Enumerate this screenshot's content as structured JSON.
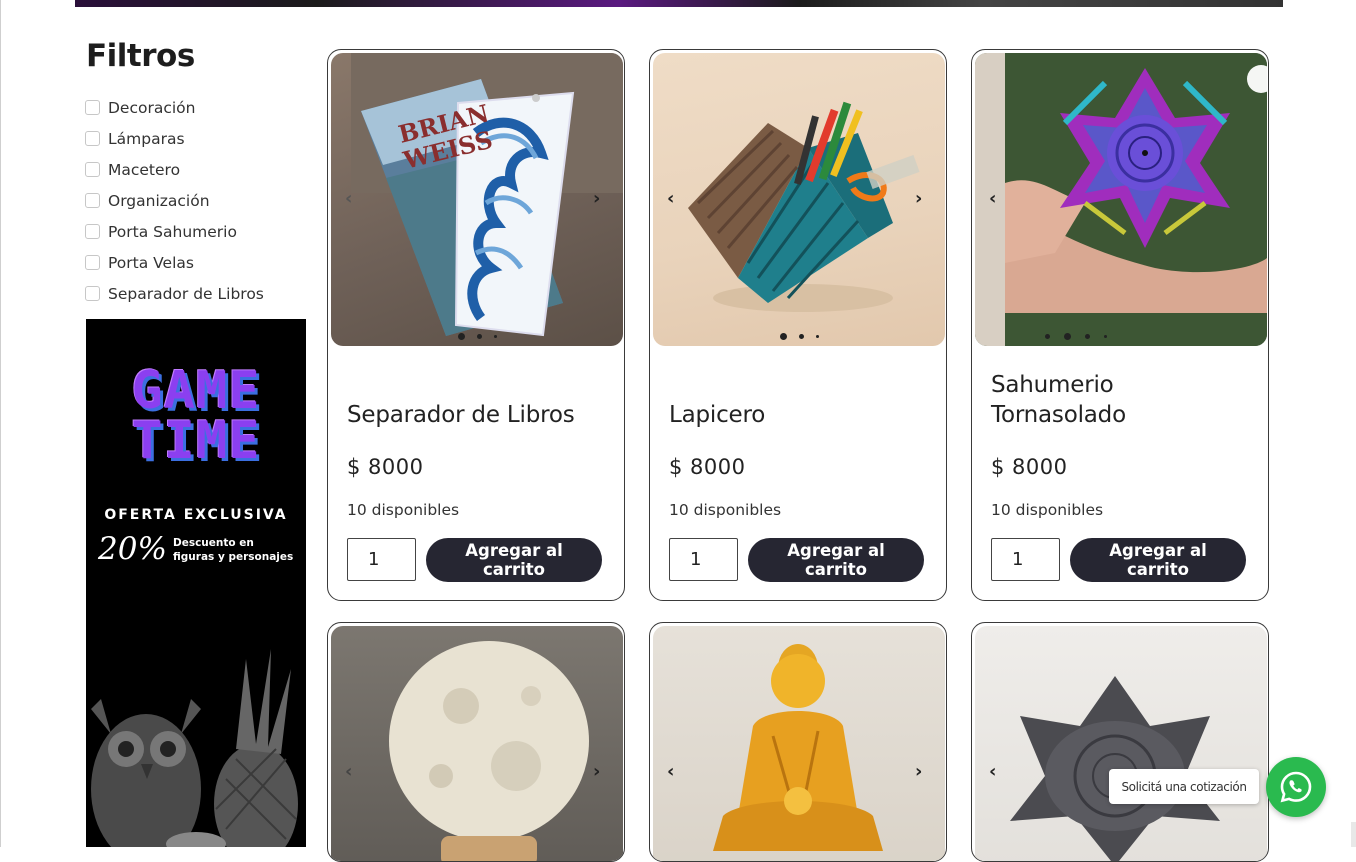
{
  "sidebar": {
    "title": "Filtros",
    "filters": [
      {
        "label": "Decoración",
        "checked": false
      },
      {
        "label": "Lámparas",
        "checked": false
      },
      {
        "label": "Macetero",
        "checked": false
      },
      {
        "label": "Organización",
        "checked": false
      },
      {
        "label": "Porta Sahumerio",
        "checked": false
      },
      {
        "label": "Porta Velas",
        "checked": false
      },
      {
        "label": "Separador de Libros",
        "checked": false
      }
    ]
  },
  "promo": {
    "line1": "GAME",
    "line2": "TIME",
    "offer": "OFERTA EXCLUSIVA",
    "percent": "20%",
    "desc_line1": "Descuento en",
    "desc_line2": "figuras y personajes"
  },
  "products": [
    {
      "title": "Separador de Libros",
      "price": "$ 8000",
      "stock": "10 disponibles",
      "qty": "1",
      "button": "Agregar al carrito",
      "image": "book-bookmark-wave",
      "slides": 3,
      "active_slide": 0
    },
    {
      "title": "Lapicero",
      "price": "$ 8000",
      "stock": "10 disponibles",
      "qty": "1",
      "button": "Agregar al carrito",
      "image": "pencil-holder",
      "slides": 3,
      "active_slide": 0
    },
    {
      "title": "Sahumerio Tornasolado",
      "price": "$ 8000",
      "stock": "10 disponibles",
      "qty": "1",
      "button": "Agregar al carrito",
      "image": "iridescent-lotus-incense-holder",
      "slides": 4,
      "active_slide": 1
    },
    {
      "image": "moon-lamp"
    },
    {
      "image": "golden-buddha"
    },
    {
      "image": "gray-lotus-incense-holder"
    }
  ],
  "whatsapp": {
    "label": "Solicitá una cotización",
    "color": "#2aba4f",
    "icon": "whatsapp-icon"
  },
  "colors": {
    "button_bg": "#262632",
    "card_border": "#3a3a3a",
    "promo_accent": "#8b3ff0"
  }
}
